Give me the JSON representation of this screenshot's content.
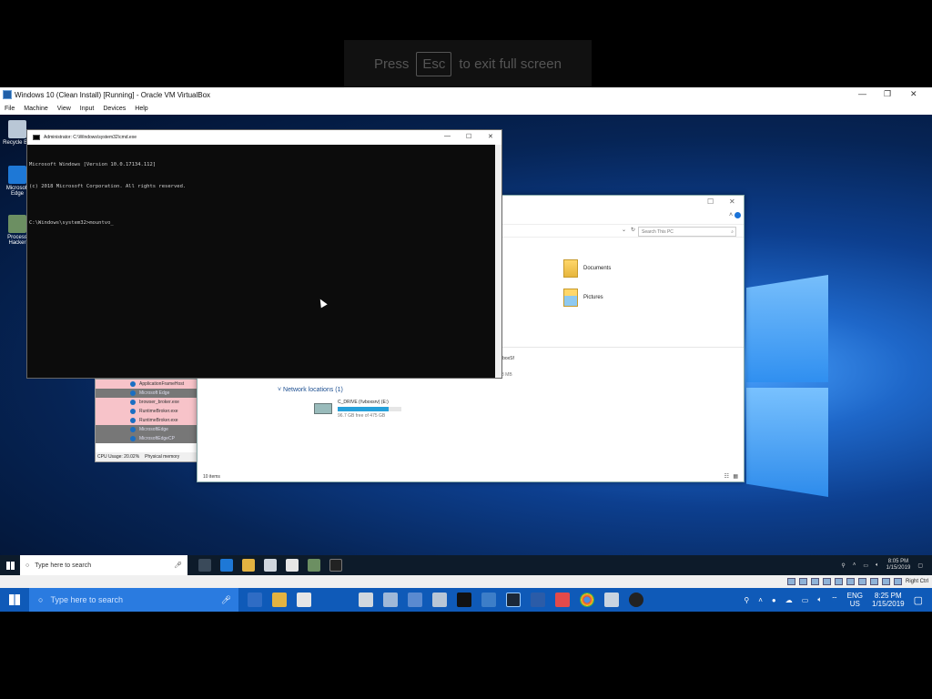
{
  "fullscreen_hint": {
    "prefix": "Press",
    "key": "Esc",
    "suffix": "to exit full screen"
  },
  "vbox": {
    "title": "Windows 10 (Clean Install) [Running] - Oracle VM VirtualBox",
    "menu": [
      "File",
      "Machine",
      "View",
      "Input",
      "Devices",
      "Help"
    ],
    "status_right": "Right Ctrl"
  },
  "desktop_icons": [
    {
      "label": "Recycle Bin",
      "icon": "recycle-bin-icon"
    },
    {
      "label": "Microsoft Edge",
      "icon": "edge-icon"
    },
    {
      "label": "Process Hacker",
      "icon": "process-hacker-icon"
    }
  ],
  "cmd": {
    "title": "Administrator: C:\\Windows\\system32\\cmd.exe",
    "lines": [
      "Microsoft Windows [Version 10.0.17134.112]",
      "(c) 2018 Microsoft Corporation. All rights reserved.",
      "",
      "C:\\Windows\\system32>mountvo_"
    ]
  },
  "explorer": {
    "search_placeholder": "Search This PC",
    "folders": [
      "Documents",
      "Pictures"
    ],
    "network_locations": "Network locations (1)",
    "drive_label": "C_DRIVE (\\\\vboxsrv) (E:)",
    "drive_free": "96.7 GB free of 475 GB",
    "drive_fill_fraction": 0.8,
    "vboxsf_fragment": "lboxSf",
    "mb_fragment": "3 MB",
    "status": "10 items"
  },
  "taskmgr": {
    "rows": [
      "ApplicationFrameHost",
      "Microsoft Edge",
      "browser_broker.exe",
      "RuntimeBroker.exe",
      "RuntimeBroker.exe",
      "MicrosoftEdge",
      "MicrosoftEdgeCP"
    ],
    "status_cpu": "CPU Usage: 20.02%",
    "status_mem": "Physical memory"
  },
  "guest_taskbar": {
    "search_placeholder": "Type here to search",
    "time": "8:05 PM",
    "date": "1/15/2019"
  },
  "host_taskbar": {
    "search_placeholder": "Type here to search",
    "lang_top": "ENG",
    "lang_bottom": "US",
    "time": "8:25 PM",
    "date": "1/15/2019"
  }
}
